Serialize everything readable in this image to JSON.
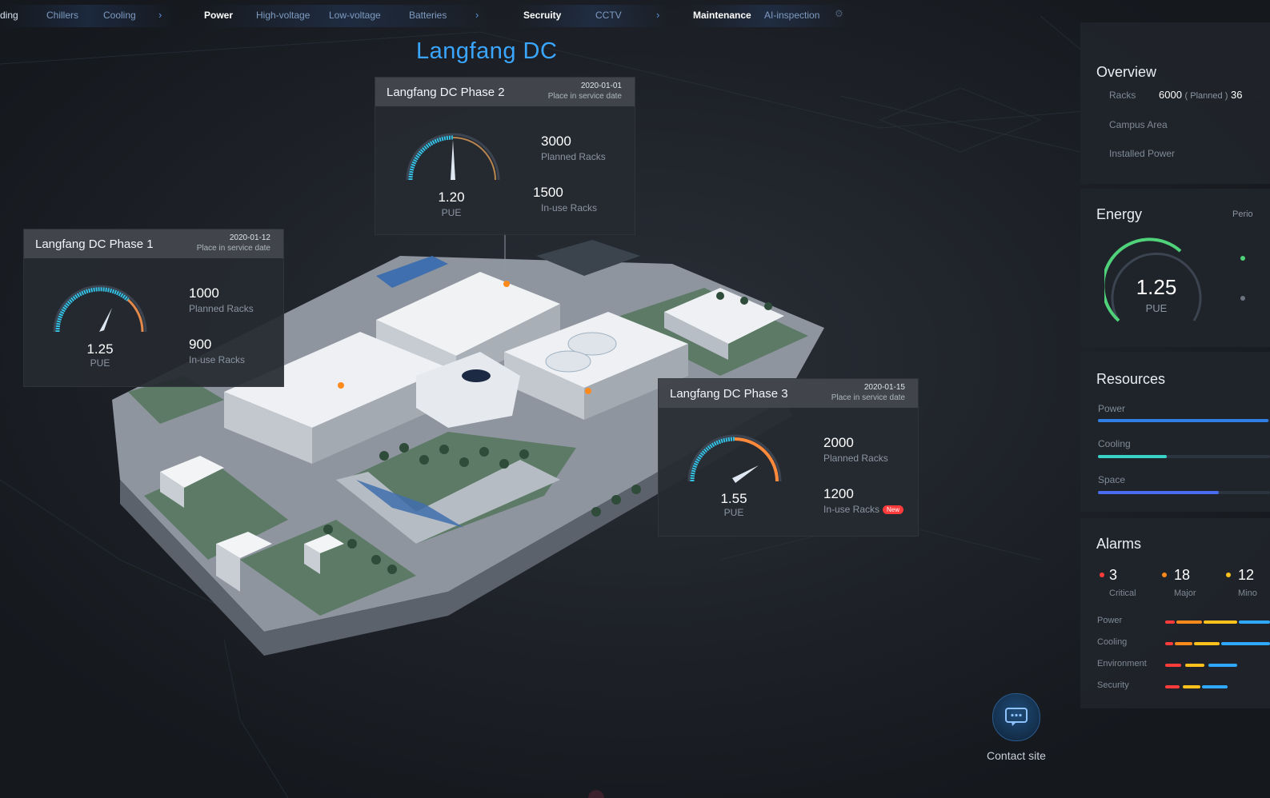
{
  "nav": {
    "items": [
      {
        "label": "ding",
        "kind": "item"
      },
      {
        "label": "Chillers",
        "kind": "item"
      },
      {
        "label": "Cooling",
        "kind": "item"
      },
      {
        "label": "Power",
        "kind": "group"
      },
      {
        "label": "High-voltage",
        "kind": "item"
      },
      {
        "label": "Low-voltage",
        "kind": "item"
      },
      {
        "label": "Batteries",
        "kind": "item"
      },
      {
        "label": "Secruity",
        "kind": "group"
      },
      {
        "label": "CCTV",
        "kind": "item"
      },
      {
        "label": "Maintenance",
        "kind": "group"
      },
      {
        "label": "AI-inspection",
        "kind": "item"
      }
    ]
  },
  "title": "Langfang DC",
  "phases": [
    {
      "title": "Langfang DC Phase 2",
      "date": "2020-01-01",
      "date_label": "Place in service date",
      "pue": "1.20",
      "pue_label": "PUE",
      "planned": "3000",
      "planned_label": "Planned Racks",
      "inuse": "1500",
      "inuse_label": "In-use Racks"
    },
    {
      "title": "Langfang DC Phase 1",
      "date": "2020-01-12",
      "date_label": "Place in service date",
      "pue": "1.25",
      "pue_label": "PUE",
      "planned": "1000",
      "planned_label": "Planned Racks",
      "inuse": "900",
      "inuse_label": "In-use Racks"
    },
    {
      "title": "Langfang DC Phase 3",
      "date": "2020-01-15",
      "date_label": "Place in service date",
      "pue": "1.55",
      "pue_label": "PUE",
      "planned": "2000",
      "planned_label": "Planned Racks",
      "inuse": "1200",
      "inuse_label": "In-use Racks",
      "badge": "New"
    }
  ],
  "overview": {
    "title": "Overview",
    "racks_label": "Racks",
    "racks_value": "6000",
    "racks_planned": "( Planned )",
    "racks_cut": "36",
    "campus_label": "Campus Area",
    "power_label": "Installed Power"
  },
  "energy": {
    "title": "Energy",
    "period_cut": "Perio",
    "pue": "1.25",
    "pue_label": "PUE"
  },
  "resources": {
    "title": "Resources",
    "items": [
      {
        "label": "Power",
        "level": 0.99,
        "color": "#2f7fe6"
      },
      {
        "label": "Cooling",
        "level": 0.4,
        "color": "#38d2c8"
      },
      {
        "label": "Space",
        "level": 0.7,
        "color": "#4a6cf0"
      }
    ]
  },
  "alarms": {
    "title": "Alarms",
    "counts": [
      {
        "value": "3",
        "label": "Critical",
        "color": "#ff3b3b"
      },
      {
        "value": "18",
        "label": "Major",
        "color": "#ff8a1c"
      },
      {
        "value": "12",
        "label": "Mino",
        "color": "#ffc21c"
      }
    ],
    "rows": [
      {
        "label": "Power"
      },
      {
        "label": "Cooling"
      },
      {
        "label": "Environment"
      },
      {
        "label": "Security"
      }
    ]
  },
  "contact": {
    "label": "Contact site"
  },
  "colors": {
    "accent": "#3aa6ff",
    "gauge_start": "#35c3e8",
    "gauge_end": "#ff8a3c",
    "critical": "#ff3b3b",
    "major": "#ff8a1c",
    "minor": "#ffc21c"
  }
}
